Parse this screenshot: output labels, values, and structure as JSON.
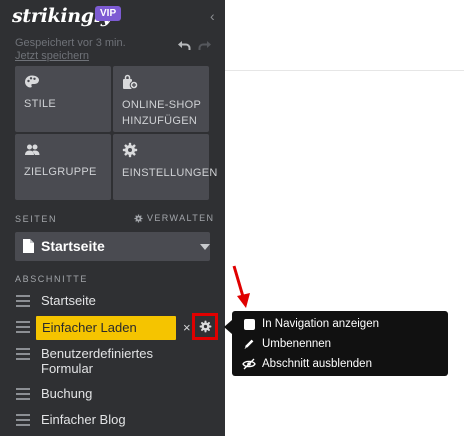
{
  "sidebar": {
    "brand": {
      "logo": "strikingly",
      "badge": "VIP"
    },
    "save_status": {
      "text": "Gespeichert vor 3 min.",
      "link": "Jetzt speichern"
    },
    "tiles": [
      {
        "label": "STILE",
        "icon": "palette-icon"
      },
      {
        "label": "ONLINE-SHOP HINZUFÜGEN",
        "icon": "shop-add-icon"
      },
      {
        "label": "ZIELGRUPPE",
        "icon": "users-icon"
      },
      {
        "label": "EINSTELLUNGEN",
        "icon": "gear-icon"
      }
    ],
    "pages": {
      "heading": "SEITEN",
      "manage": "VERWALTEN",
      "selected_page": "Startseite"
    },
    "sections": {
      "heading": "ABSCHNITTE",
      "items": [
        {
          "label": "Startseite"
        },
        {
          "label": "Einfacher Laden",
          "highlighted": true
        },
        {
          "label": "Benutzerdefiniertes Formular"
        },
        {
          "label": "Buchung"
        },
        {
          "label": "Einfacher Blog"
        }
      ],
      "remove_glyph": "×"
    }
  },
  "section_menu": {
    "items": [
      {
        "label": "In Navigation anzeigen",
        "icon": "checkbox-icon",
        "checked": false
      },
      {
        "label": "Umbenennen",
        "icon": "pencil-icon"
      },
      {
        "label": "Abschnitt ausblenden",
        "icon": "eye-off-icon"
      }
    ]
  },
  "colors": {
    "sidebar_bg": "#2f3033",
    "tile_bg": "#4a4b51",
    "badge": "#7d5bd3",
    "highlight": "#f5c400",
    "annotation": "#e00000",
    "popup_bg": "#111111"
  }
}
